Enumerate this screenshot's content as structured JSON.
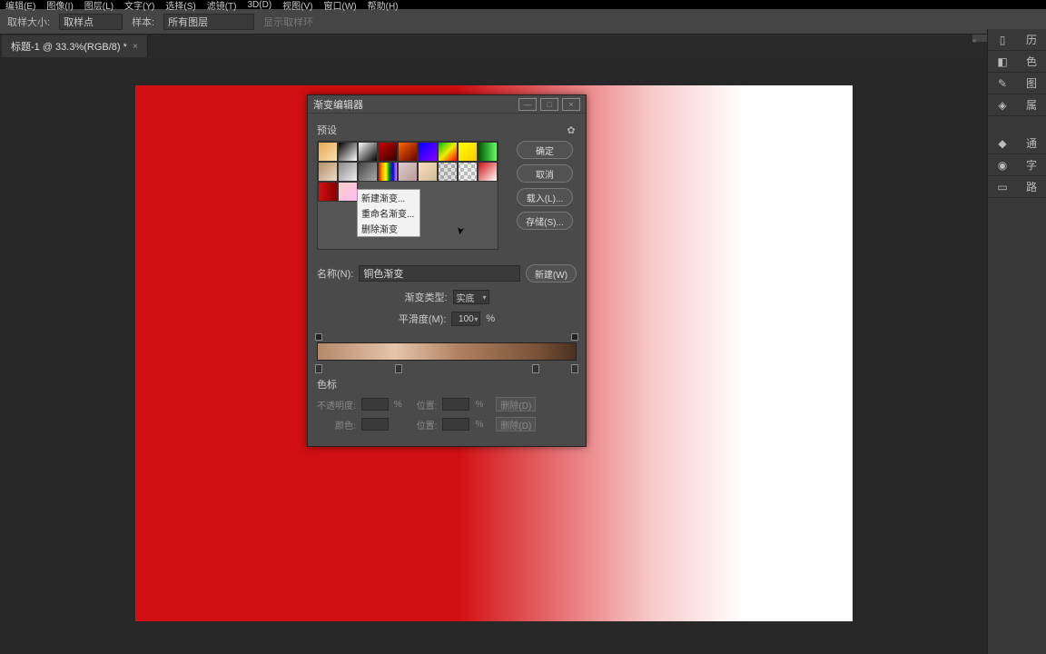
{
  "menubar": [
    "编辑(E)",
    "图像(I)",
    "图层(L)",
    "文字(Y)",
    "选择(S)",
    "滤镜(T)",
    "3D(D)",
    "视图(V)",
    "窗口(W)",
    "帮助(H)"
  ],
  "options": {
    "sample_label": "取样大小:",
    "sample_value": "取样点",
    "layer_label": "样本:",
    "layer_value": "所有图层",
    "ring_label": "显示取样环"
  },
  "tab": {
    "title": "标题-1 @ 33.3%(RGB/8) *",
    "close": "×"
  },
  "dialog": {
    "title": "渐变编辑器",
    "minimize": "—",
    "maximize": "□",
    "close": "×",
    "presets_label": "预设",
    "buttons": {
      "ok": "确定",
      "cancel": "取消",
      "load": "载入(L)...",
      "save": "存储(S)...",
      "new": "新建(W)"
    },
    "name_label": "名称(N):",
    "name_value": "铜色渐变",
    "type_label": "渐变类型:",
    "type_value": "实底",
    "smooth_label": "平滑度(M):",
    "smooth_value": "100",
    "pct": "%",
    "stops_label": "色标",
    "opacity_label": "不透明度:",
    "position_label": "位置:",
    "color_label": "颜色:",
    "delete_label": "删除(D)"
  },
  "context_menu": [
    "新建渐变...",
    "重命名渐变...",
    "删除渐变"
  ],
  "right_icons": [
    "▯",
    "◧",
    "✎",
    "◈",
    "◆",
    "◉",
    "▭"
  ],
  "right_labels": [
    "历",
    "色",
    "图",
    "属",
    "通",
    "字",
    "路"
  ]
}
